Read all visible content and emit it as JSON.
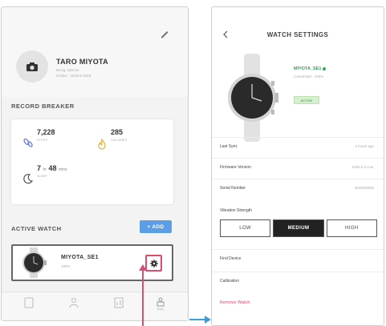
{
  "left_screen": {
    "profile": {
      "name": "TARO MIYOTA",
      "sub_lines": [
        "60 kg, 168 cm",
        "Unisex · version 2018"
      ]
    },
    "record_breaker": {
      "title": "RECORD BREAKER",
      "items": [
        {
          "icon": "footprints-icon",
          "value": "7,228",
          "unit": "",
          "sub": "STEPS"
        },
        {
          "icon": "flame-icon",
          "value": "285",
          "unit": "",
          "sub": "CALORIES"
        },
        {
          "icon": "moon-icon",
          "value": "7",
          "unit": "hr",
          "value2": "48",
          "unit2": "mins",
          "sub": "SLEEP"
        }
      ]
    },
    "active_watch": {
      "title": "ACTIVE WATCH",
      "add_label": "+ ADD",
      "watch_name": "MIYOTA_SE1",
      "watch_sub": "100%"
    },
    "bottom_nav": [
      "",
      "",
      "",
      "Body"
    ]
  },
  "right_screen": {
    "title": "WATCH SETTINGS",
    "watch_name": "MIYOTA_SE1",
    "watch_sub": "Connected · 100%",
    "badge": "ACTIVE",
    "rows": [
      {
        "label": "Last Sync",
        "value": "4 hours ago"
      },
      {
        "label": "Firmware Version",
        "value": "1000 0.2.4.a1"
      },
      {
        "label": "Serial Number",
        "value": "W10000000"
      }
    ],
    "vibration": {
      "label": "Vibration Strength",
      "options": [
        "LOW",
        "MEDIUM",
        "HIGH"
      ],
      "selected": "MEDIUM"
    },
    "rows_bottom": [
      {
        "label": "Find Device"
      },
      {
        "label": "Calibration"
      }
    ],
    "remove_label": "Remove Watch"
  },
  "colors": {
    "accent_pink": "#d2507a",
    "accent_blue": "#3aa0dc",
    "add_button": "#5b9ee6",
    "connected_green": "#2faa57",
    "remove_red": "#d9496a"
  }
}
